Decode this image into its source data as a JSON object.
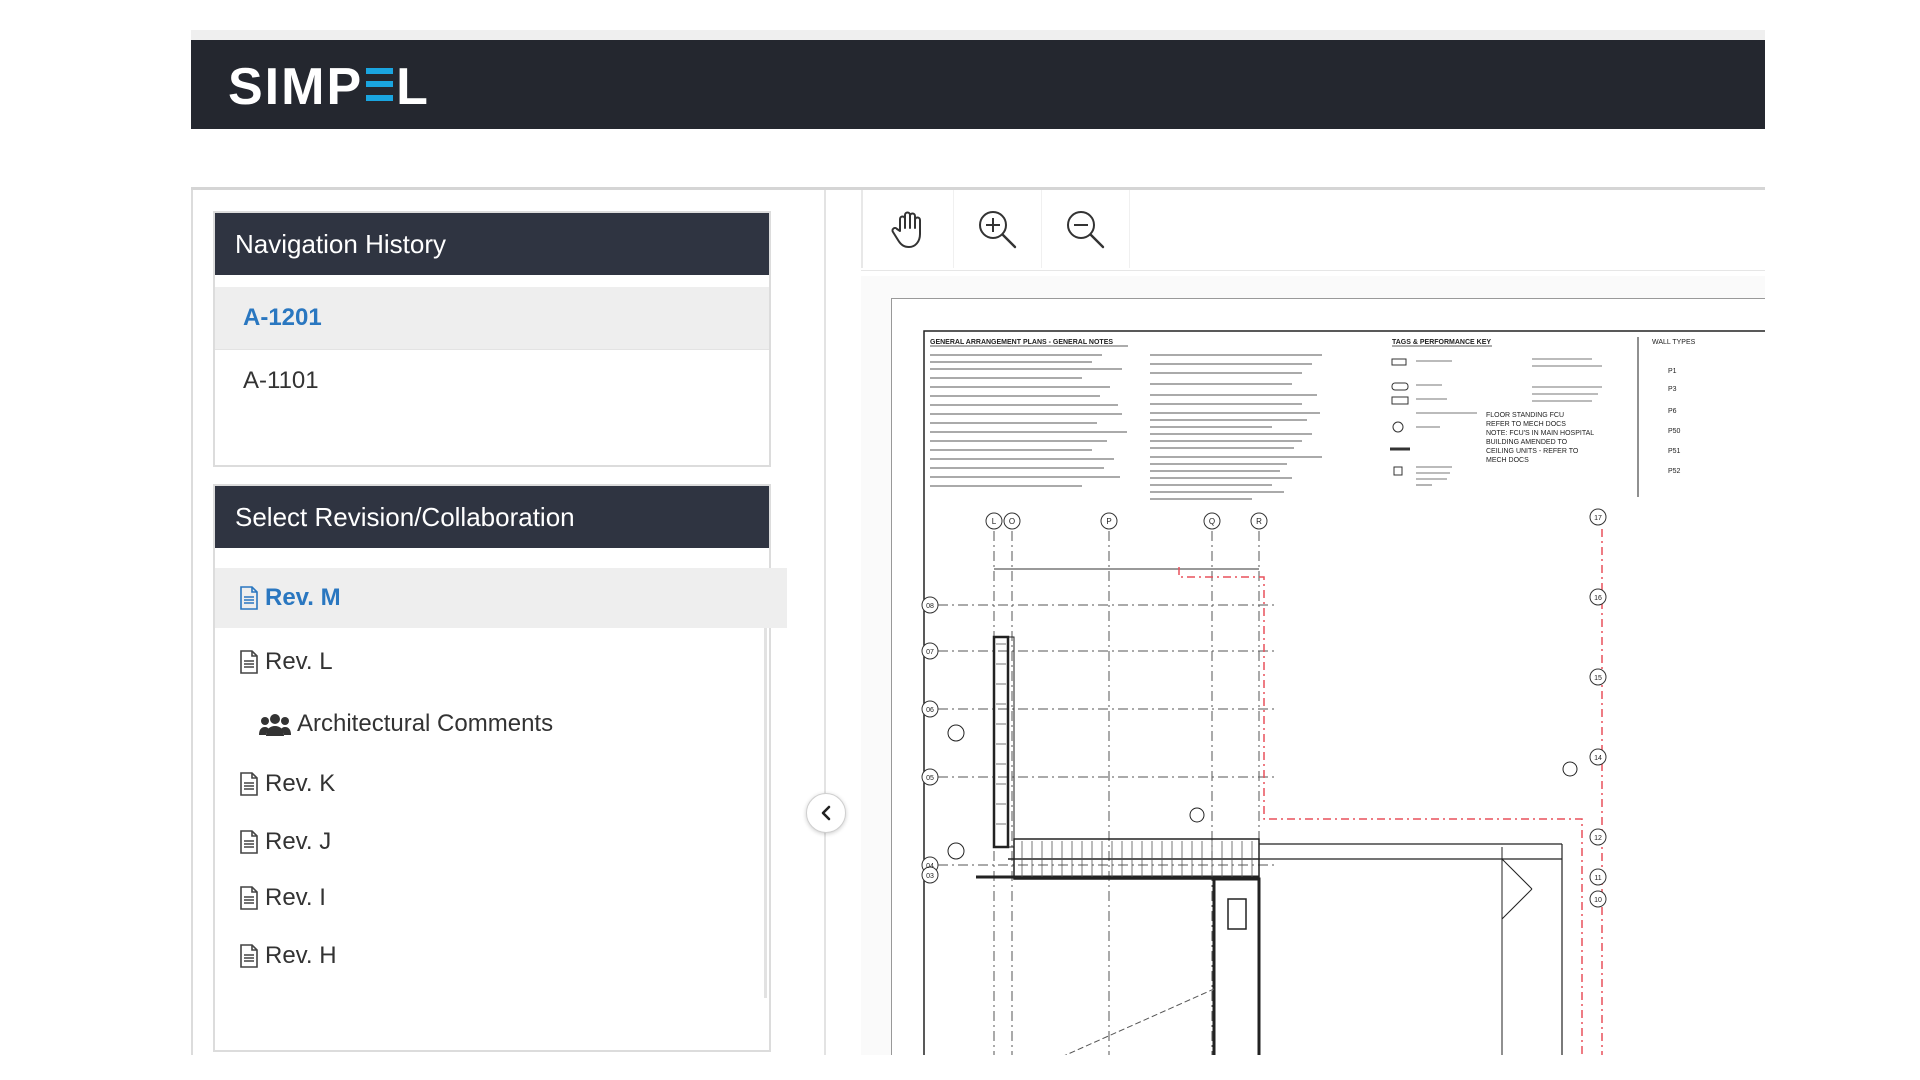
{
  "app": {
    "logo_text_left": "SIMP",
    "logo_text_right": "L",
    "brand_accent": "#1aa5e0",
    "header_color": "#24272f"
  },
  "nav_history": {
    "title": "Navigation History",
    "items": [
      {
        "label": "A-1201",
        "active": true
      },
      {
        "label": "A-1101",
        "active": false
      }
    ]
  },
  "revisions": {
    "title": "Select Revision/Collaboration",
    "items": [
      {
        "label": "Rev. M",
        "icon": "document-icon",
        "active": true
      },
      {
        "label": "Rev. L",
        "icon": "document-icon",
        "active": false
      },
      {
        "label": "Architectural Comments",
        "icon": "team-icon",
        "active": false
      },
      {
        "label": "Rev. K",
        "icon": "document-icon",
        "active": false
      },
      {
        "label": "Rev. J",
        "icon": "document-icon",
        "active": false
      },
      {
        "label": "Rev. I",
        "icon": "document-icon",
        "active": false
      },
      {
        "label": "Rev. H",
        "icon": "document-icon",
        "active": false
      }
    ]
  },
  "viewer": {
    "tools": [
      "pan-hand-icon",
      "zoom-in-icon",
      "zoom-out-icon"
    ],
    "drawing": {
      "notes_title": "GENERAL ARRANGEMENT PLANS - GENERAL NOTES",
      "key_title": "TAGS & PERFORMANCE KEY",
      "wall_types_title": "WALL TYPES",
      "floor_note": [
        "FLOOR STANDING FCU",
        "REFER TO MECH DOCS",
        "NOTE: FCU'S IN MAIN HOSPITAL",
        "BUILDING AMENDED TO",
        "CEILING UNITS - REFER TO",
        "MECH DOCS"
      ],
      "wall_type_codes": [
        "P1",
        "P3",
        "P6",
        "P50",
        "P51",
        "P52"
      ],
      "grid_col_labels": [
        "L",
        "O",
        "P",
        "Q",
        "R"
      ],
      "grid_row_labels": [
        "08",
        "07",
        "06",
        "05",
        "04",
        "03"
      ],
      "right_grid_labels": [
        "17",
        "16",
        "15",
        "14",
        "12",
        "11",
        "10"
      ]
    }
  }
}
